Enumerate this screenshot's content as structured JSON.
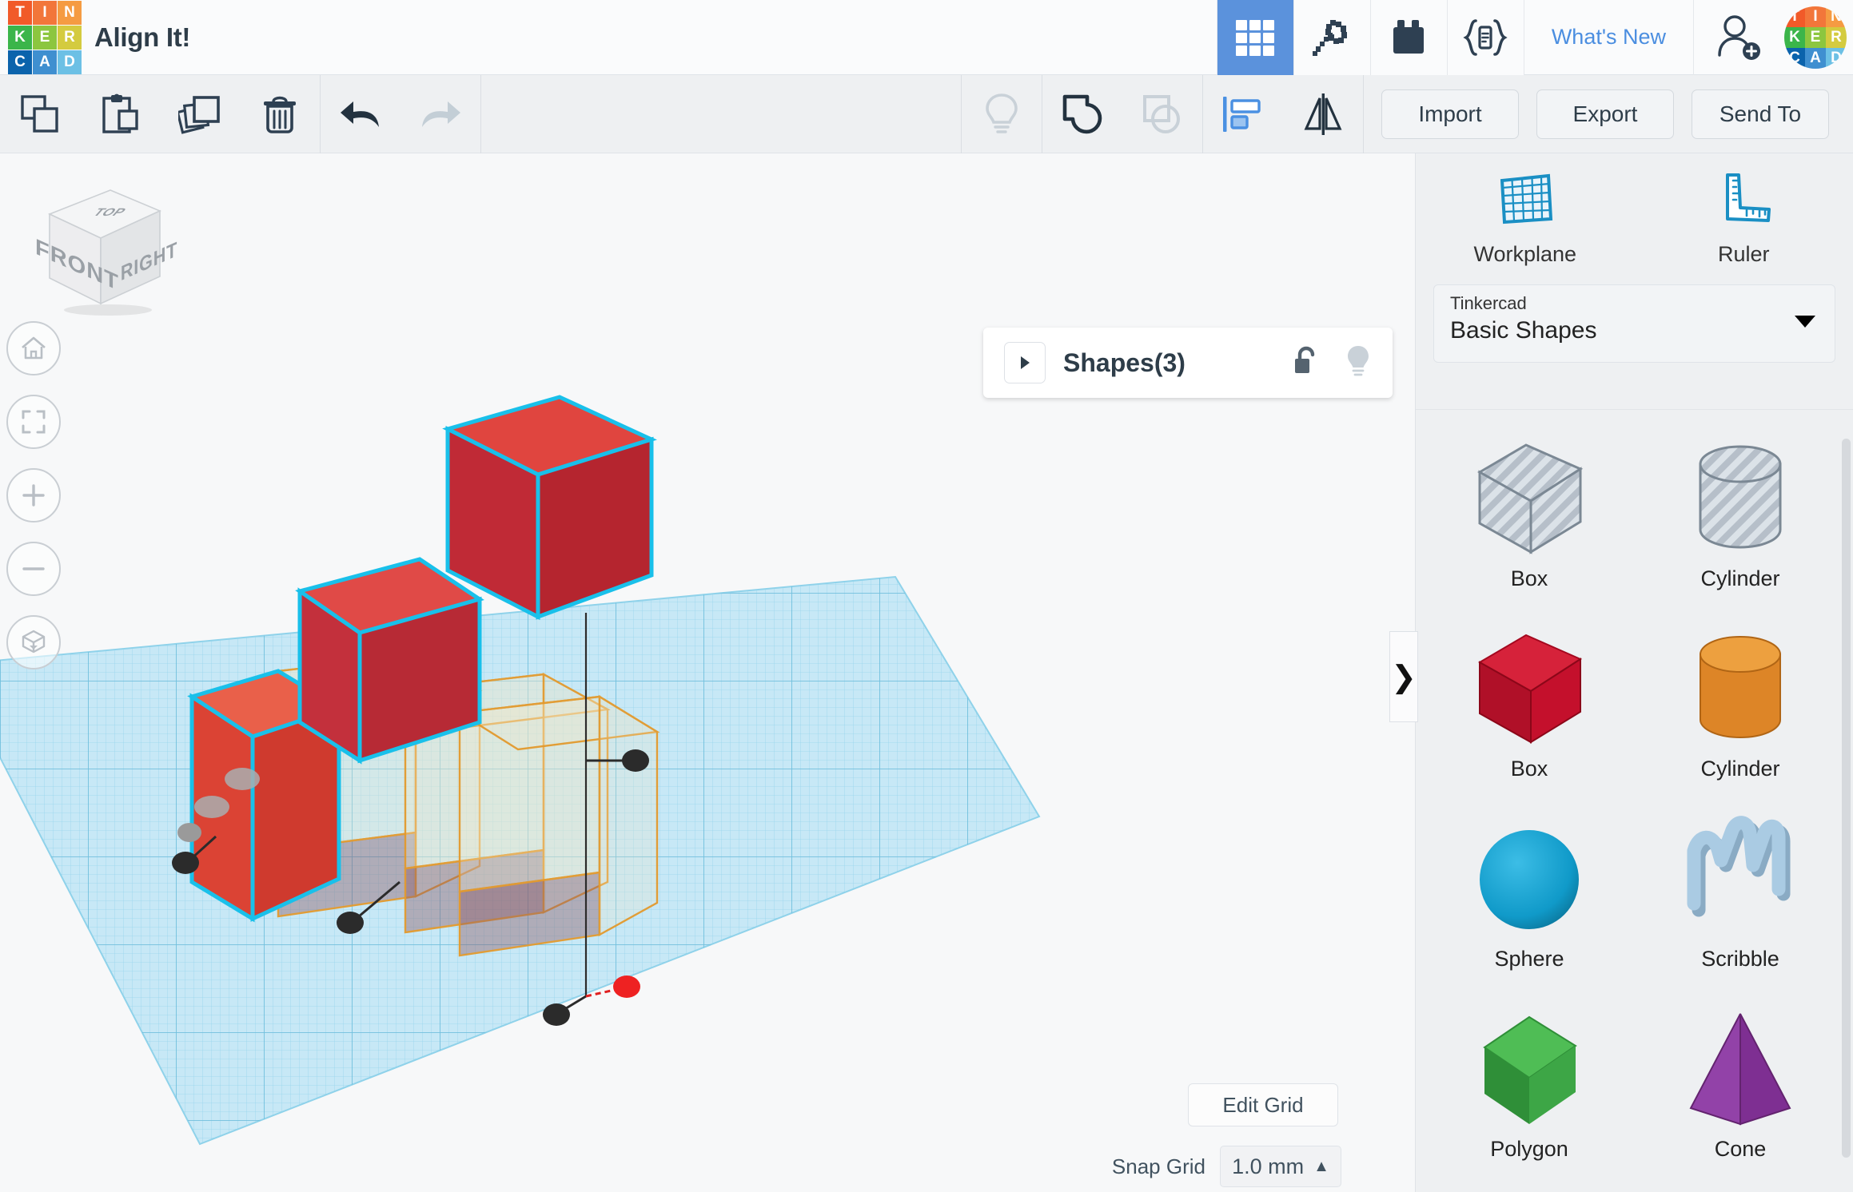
{
  "app": {
    "logo_letters": [
      "T",
      "I",
      "N",
      "K",
      "E",
      "R",
      "C",
      "A",
      "D"
    ],
    "logo_colors": [
      "#f15a29",
      "#f2763a",
      "#f59b42",
      "#3bb54a",
      "#8cc63f",
      "#d4cb3f",
      "#0b63ac",
      "#3f8fd0",
      "#6cc0e5"
    ],
    "document_title": "Align It!"
  },
  "header": {
    "tools": [
      {
        "name": "grid-view-icon",
        "label": "Grid",
        "active": true
      },
      {
        "name": "minecraft-pickaxe-icon",
        "label": "Minecraft",
        "active": false
      },
      {
        "name": "lego-brick-icon",
        "label": "Blocks",
        "active": false
      },
      {
        "name": "codeblocks-icon",
        "label": "Codeblocks",
        "active": false
      }
    ],
    "whats_new": "What's New",
    "add_user_icon": "add-user-icon",
    "avatar_icon": "tinkercad-avatar"
  },
  "toolbar": {
    "left_tools": [
      {
        "name": "copy-icon",
        "label": "Copy",
        "enabled": true
      },
      {
        "name": "paste-icon",
        "label": "Paste",
        "enabled": true
      },
      {
        "name": "duplicate-icon",
        "label": "Duplicate",
        "enabled": true
      },
      {
        "name": "delete-icon",
        "label": "Delete",
        "enabled": true
      }
    ],
    "history_tools": [
      {
        "name": "undo-icon",
        "label": "Undo",
        "enabled": true
      },
      {
        "name": "redo-icon",
        "label": "Redo",
        "enabled": false
      }
    ],
    "mid_tools": [
      {
        "name": "lightbulb-icon",
        "label": "Hide",
        "enabled": false
      },
      {
        "name": "group-icon",
        "label": "Group",
        "enabled": true
      },
      {
        "name": "ungroup-icon",
        "label": "Ungroup",
        "enabled": false
      }
    ],
    "align_tools": [
      {
        "name": "align-icon",
        "label": "Align",
        "enabled": true,
        "active": true
      },
      {
        "name": "mirror-icon",
        "label": "Mirror",
        "enabled": true,
        "active": false
      }
    ],
    "buttons": [
      {
        "name": "import-button",
        "label": "Import"
      },
      {
        "name": "export-button",
        "label": "Export"
      },
      {
        "name": "send-to-button",
        "label": "Send To"
      }
    ]
  },
  "canvas": {
    "viewcube": {
      "top": "TOP",
      "front": "FRONT",
      "right": "RIGHT"
    },
    "nav_buttons": [
      {
        "name": "home-view-button",
        "icon": "home-icon"
      },
      {
        "name": "fit-to-view-button",
        "icon": "fit-view-icon"
      },
      {
        "name": "zoom-in-button",
        "icon": "plus-icon"
      },
      {
        "name": "zoom-out-button",
        "icon": "minus-icon"
      },
      {
        "name": "perspective-toggle-button",
        "icon": "cube-ortho-icon"
      }
    ],
    "shapes_panel": {
      "title": "Shapes(3)",
      "expand_icon": "chevron-right-icon",
      "lock_icon": "unlock-icon",
      "visibility_icon": "lightbulb-icon"
    },
    "edit_grid_label": "Edit Grid",
    "snap_grid_label": "Snap Grid",
    "snap_grid_value": "1.0 mm",
    "snap_caret": "▲",
    "collapse_handle": "❯",
    "objects": [
      {
        "name": "box-top-selected",
        "color": "#c02a36",
        "selected": true
      },
      {
        "name": "box-middle-selected",
        "color": "#c3303c",
        "selected": true
      },
      {
        "name": "box-ground-selected",
        "color": "#df4b3c",
        "selected": true
      },
      {
        "name": "ghost-box-1",
        "color": "#e39a2d",
        "ghost": true
      },
      {
        "name": "ghost-box-2",
        "color": "#e39a2d",
        "ghost": true
      },
      {
        "name": "ghost-box-3",
        "color": "#e39a2d",
        "ghost": true
      }
    ],
    "align_handles": [
      {
        "name": "align-handle",
        "color": "#2b2b2b"
      },
      {
        "name": "align-handle",
        "color": "#2b2b2b"
      },
      {
        "name": "align-handle",
        "color": "#2b2b2b"
      },
      {
        "name": "align-handle",
        "color": "#2b2b2b"
      },
      {
        "name": "align-handle",
        "color": "#9a9a9a"
      },
      {
        "name": "align-handle-active",
        "color": "#ee2222"
      }
    ],
    "colors": {
      "workplane": "#bfe6f5",
      "workplane_grid": "#7fc8e3",
      "selection_outline": "#19c0ea",
      "ghost_outline": "#e39a2d"
    }
  },
  "right_panel": {
    "tools": [
      {
        "name": "workplane-tool",
        "label": "Workplane",
        "icon": "workplane-icon"
      },
      {
        "name": "ruler-tool",
        "label": "Ruler",
        "icon": "ruler-icon"
      }
    ],
    "library": {
      "label": "Tinkercad",
      "value": "Basic Shapes"
    },
    "shapes": [
      {
        "name": "Box",
        "kind": "box",
        "style": "hole"
      },
      {
        "name": "Cylinder",
        "kind": "cylinder",
        "style": "hole"
      },
      {
        "name": "Box",
        "kind": "box",
        "color": "#c4102c"
      },
      {
        "name": "Cylinder",
        "kind": "cylinder",
        "color": "#e08a2c"
      },
      {
        "name": "Sphere",
        "kind": "sphere",
        "color": "#0f9dc9"
      },
      {
        "name": "Scribble",
        "kind": "scribble",
        "color": "#a6c8e0"
      },
      {
        "name": "Polygon",
        "kind": "polygon",
        "color": "#4caf50"
      },
      {
        "name": "Cone",
        "kind": "cone",
        "color": "#8e3fa0"
      }
    ]
  }
}
